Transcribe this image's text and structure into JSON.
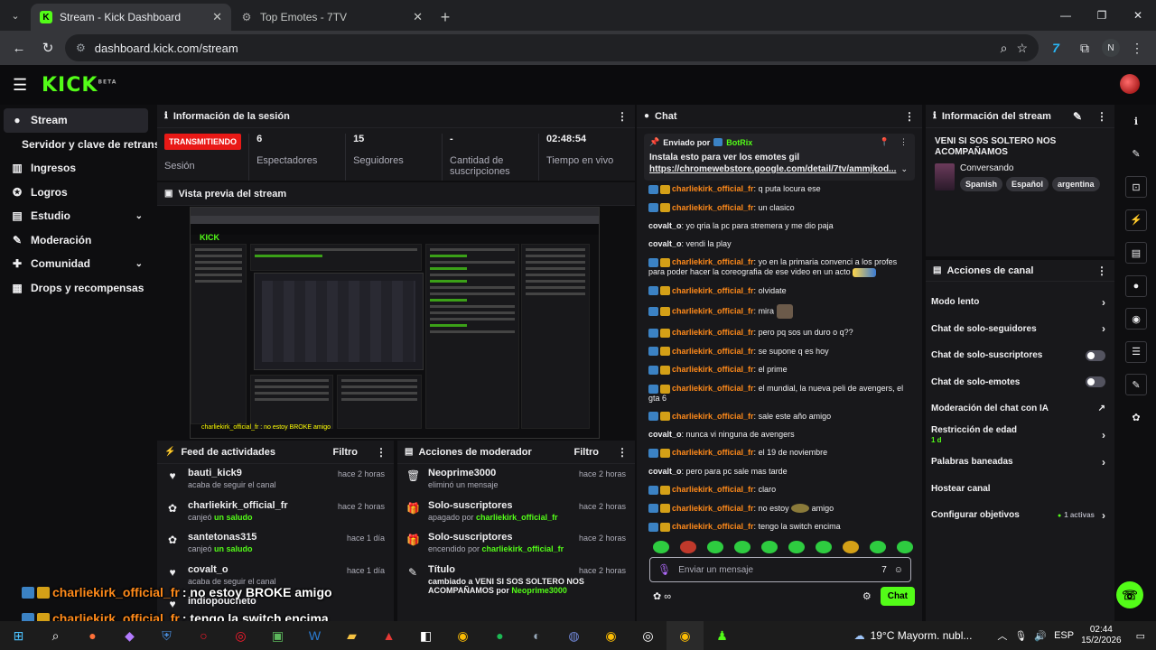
{
  "browser": {
    "tabs": [
      {
        "title": "Stream - Kick Dashboard",
        "active": true
      },
      {
        "title": "Top Emotes - 7TV",
        "active": false
      }
    ],
    "url": "dashboard.kick.com/stream",
    "profile_initial": "N"
  },
  "header": {
    "logo": "KICK",
    "logo_tag": "BETA"
  },
  "sidebar": {
    "items": [
      {
        "label": "Stream",
        "icon": "stream-icon"
      },
      {
        "label": "Servidor y clave de retransmisión",
        "icon": ""
      },
      {
        "label": "Ingresos",
        "icon": "chart-icon"
      },
      {
        "label": "Logros",
        "icon": "trophy-icon"
      },
      {
        "label": "Estudio",
        "icon": "studio-icon"
      },
      {
        "label": "Moderación",
        "icon": "wrench-icon"
      },
      {
        "label": "Comunidad",
        "icon": "community-icon"
      },
      {
        "label": "Drops y recompensas",
        "icon": "drops-icon"
      }
    ]
  },
  "session": {
    "title": "Información de la sesión",
    "status_badge": "TRANSMITIENDO",
    "status_label": "Sesión",
    "stats": [
      {
        "value": "6",
        "label": "Espectadores"
      },
      {
        "value": "15",
        "label": "Seguidores"
      },
      {
        "value": "-",
        "label": "Cantidad de suscripciones"
      },
      {
        "value": "02:48:54",
        "label": "Tiempo en vivo"
      }
    ]
  },
  "preview": {
    "title": "Vista previa del stream",
    "toast": "charliekirk_official_fr : no estoy BROKE amigo"
  },
  "activity_feed": {
    "title": "Feed de actividades",
    "filter": "Filtro",
    "items": [
      {
        "name": "bauti_kick9",
        "desc": "acaba de seguir el canal",
        "time": "hace 2 horas",
        "icon": "heart-icon"
      },
      {
        "name": "charliekirk_official_fr",
        "desc": "canjeó ",
        "desc_hl": "un saludo",
        "time": "hace 2 horas",
        "icon": "reward-icon"
      },
      {
        "name": "santetonas315",
        "desc": "canjeó ",
        "desc_hl": "un saludo",
        "time": "hace 1 día",
        "icon": "reward-icon"
      },
      {
        "name": "covalt_o",
        "desc": "acaba de seguir el canal",
        "time": "hace 1 día",
        "icon": "heart-icon"
      },
      {
        "name": "indiopoucheto",
        "desc": "",
        "time": "",
        "icon": "heart-icon"
      }
    ]
  },
  "mod_actions": {
    "title": "Acciones de moderador",
    "filter": "Filtro",
    "items": [
      {
        "name": "Neoprime3000",
        "desc": "eliminó un mensaje",
        "time": "hace 2 horas",
        "icon": "trash-icon"
      },
      {
        "name": "Solo-suscriptores",
        "desc": "apagado por ",
        "desc_hl": "charliekirk_official_fr",
        "time": "hace 2 horas",
        "icon": "gift-icon"
      },
      {
        "name": "Solo-suscriptores",
        "desc": "encendido por ",
        "desc_hl": "charliekirk_official_fr",
        "time": "hace 2 horas",
        "icon": "gift-icon"
      },
      {
        "name": "Título",
        "desc": "cambiado a VENI SI SOS SOLTERO NOS ACOMPAÑAMOS por ",
        "desc_hl": "Neoprime3000",
        "time": "hace 2 horas",
        "icon": "title-icon"
      }
    ]
  },
  "chat": {
    "title": "Chat",
    "pinned": {
      "sent_by": "Enviado por",
      "bot": "BotRix",
      "text": "Instala esto para ver los emotes gil",
      "link": "https://chromewebstore.google.com/detail/7tv/ammjkod..."
    },
    "messages": [
      {
        "user": "charliekirk_official_fr",
        "text": "q puta locura ese",
        "badges": true
      },
      {
        "user": "charliekirk_official_fr",
        "text": "un clasico",
        "badges": true
      },
      {
        "user": "covalt_o",
        "text": "yo qria la pc para stremera y me dio paja",
        "badges": false
      },
      {
        "user": "covalt_o",
        "text": "vendi la play",
        "badges": false
      },
      {
        "user": "charliekirk_official_fr",
        "text": "yo en la primaria convenci a los profes para poder hacer la coreografia de ese video en un acto",
        "badges": true,
        "emote": true
      },
      {
        "user": "charliekirk_official_fr",
        "text": "olvidate",
        "badges": true
      },
      {
        "user": "charliekirk_official_fr",
        "text": "mira",
        "badges": true,
        "emote_sq": true
      },
      {
        "user": "charliekirk_official_fr",
        "text": "pero pq sos un duro o q??",
        "badges": true
      },
      {
        "user": "charliekirk_official_fr",
        "text": "se supone q es hoy",
        "badges": true
      },
      {
        "user": "charliekirk_official_fr",
        "text": "el prime",
        "badges": true
      },
      {
        "user": "charliekirk_official_fr",
        "text": "el mundial, la nueva peli de avengers, el gta 6",
        "badges": true
      },
      {
        "user": "charliekirk_official_fr",
        "text": "sale este año amigo",
        "badges": true
      },
      {
        "user": "covalt_o",
        "text": "nunca vi ninguna de avengers",
        "badges": false
      },
      {
        "user": "charliekirk_official_fr",
        "text": "el 19 de noviembre",
        "badges": true
      },
      {
        "user": "covalt_o",
        "text": "pero para pc sale mas tarde",
        "badges": false
      },
      {
        "user": "charliekirk_official_fr",
        "text": "claro",
        "badges": true
      },
      {
        "user": "charliekirk_official_fr",
        "text": "no estoy",
        "text2": "amigo",
        "badges": true,
        "emote_gob": true
      },
      {
        "user": "charliekirk_official_fr",
        "text": "tengo la switch encima",
        "badges": true
      }
    ],
    "input_placeholder": "Enviar un mensaje",
    "send_label": "Chat"
  },
  "stream_info": {
    "title": "Información del stream",
    "stream_title": "VENI SI SOS SOLTERO NOS ACOMPAÑAMOS",
    "category": "Conversando",
    "tags": [
      "Spanish",
      "Español",
      "argentina"
    ]
  },
  "channel_actions": {
    "title": "Acciones de canal",
    "items": [
      {
        "label": "Modo lento",
        "control": "chevron"
      },
      {
        "label": "Chat de solo-seguidores",
        "control": "chevron"
      },
      {
        "label": "Chat de solo-suscriptores",
        "control": "toggle"
      },
      {
        "label": "Chat de solo-emotes",
        "control": "toggle"
      },
      {
        "label": "Moderación del chat con IA",
        "control": "external"
      },
      {
        "label": "Restricción de edad",
        "sub": "1 d",
        "control": "chevron"
      },
      {
        "label": "Palabras baneadas",
        "control": "chevron"
      },
      {
        "label": "Hostear canal",
        "control": "none"
      },
      {
        "label": "Configurar objetivos",
        "active": "1 activas",
        "control": "chevron"
      }
    ]
  },
  "overlay": [
    {
      "user": "charliekirk_official_fr",
      "text": ": no estoy BROKE amigo"
    },
    {
      "user": "charliekirk_official_fr",
      "text": ": tengo la switch encima"
    }
  ],
  "taskbar": {
    "weather": "19°C  Mayorm. nubl...",
    "lang": "ESP",
    "time": "02:44",
    "date": "15/2/2026"
  },
  "colors": {
    "accent": "#53fc18",
    "live": "#e91916",
    "username": "#ff8a1a"
  }
}
